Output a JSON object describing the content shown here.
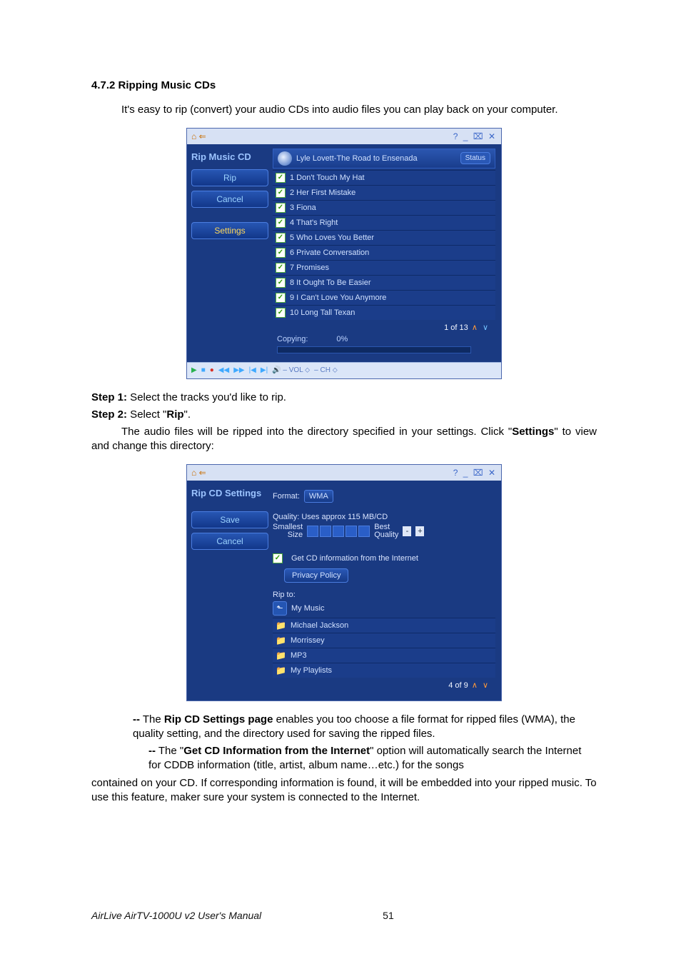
{
  "heading": "4.7.2 Ripping Music CDs",
  "intro": "It's easy to rip (convert) your audio CDs into audio files you can play back on your computer.",
  "shot1": {
    "title_left": "⌂ ⇐",
    "title_right": "? _ ⌧ ✕",
    "side_title": "Rip Music CD",
    "btn_rip": "Rip",
    "btn_cancel": "Cancel",
    "btn_settings": "Settings",
    "album": "Lyle Lovett-The Road to Ensenada",
    "status_label": "Status",
    "tracks": [
      "1 Don't Touch My Hat",
      "2 Her First Mistake",
      "3 Fiona",
      "4 That's Right",
      "5 Who Loves You Better",
      "6 Private Conversation",
      "7 Promises",
      "8 It Ought To Be Easier",
      "9 I Can't Love You Anymore",
      "10 Long Tall Texan"
    ],
    "pager": "1 of 13",
    "copying_label": "Copying:",
    "copying_pct": "0%",
    "media_bar": "▶  ■  ●  ◀◀  ▶▶  |◀  ▶|   🔊 – VOL ⬦   – CH ⬦"
  },
  "step1_label": "Step 1:",
  "step1_text": " Select the tracks you'd like to rip.",
  "step2_label": "Step 2:",
  "step2_text": " Select \"",
  "step2_bold": "Rip",
  "step2_tail": "\".",
  "para2a": "The audio files will be ripped into the directory specified in your settings. Click \"",
  "para2b": "Settings",
  "para2c": "\" to view and change this directory:",
  "shot2": {
    "title_left": "⌂ ⇐",
    "title_right": "? _ ⌧ ✕",
    "side_title": "Rip CD Settings",
    "btn_save": "Save",
    "btn_cancel": "Cancel",
    "format_label": "Format:",
    "format_value": "WMA",
    "quality_line": "Quality: Uses approx 115 MB/CD",
    "slider_left_a": "Smallest",
    "slider_left_b": "Size",
    "slider_right_a": "Best",
    "slider_right_b": "Quality",
    "get_cd_info": "Get CD information from the Internet",
    "privacy_btn": "Privacy Policy",
    "rip_to": "Rip to:",
    "rip_to_value": "My Music",
    "folders": [
      "Michael Jackson",
      "Morrissey",
      "MP3",
      "My Playlists"
    ],
    "pager": "4 of 9"
  },
  "bullets": {
    "dash": "--",
    "b1_pre": " The ",
    "b1_bold": "Rip CD Settings page",
    "b1_post": " enables you too choose a file format for ripped files (WMA), the quality setting, and the directory used for saving the ripped files.",
    "b2_pre": " The \"",
    "b2_bold": "Get CD Information from the Internet",
    "b2_post": "\" option will automatically search the Internet for CDDB information (title, artist, album name…etc.) for the songs",
    "b3": "contained on your CD. If corresponding information is found, it will be embedded into your ripped music. To use this feature, maker sure your system is connected to the Internet."
  },
  "footer_title": "AirLive AirTV-1000U v2 User's Manual",
  "page_number": "51"
}
